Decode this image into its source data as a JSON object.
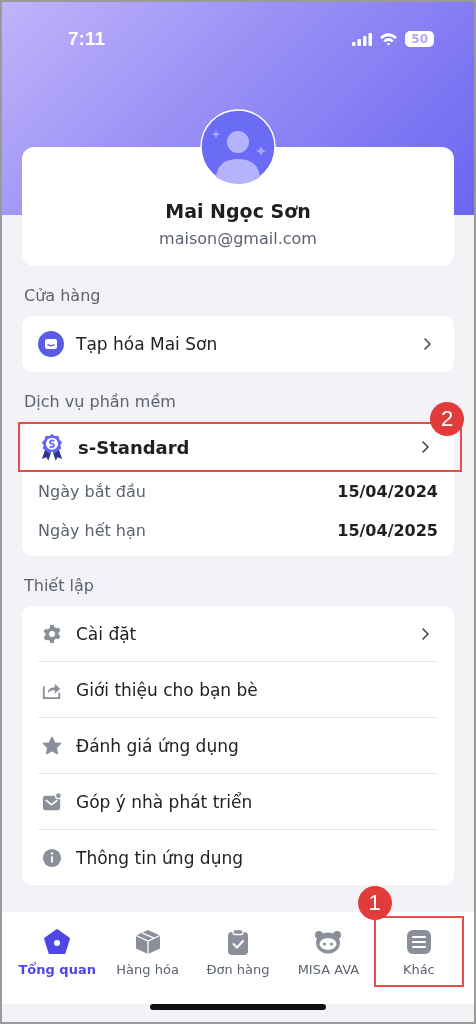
{
  "status_bar": {
    "time": "7:11",
    "battery": "50"
  },
  "profile": {
    "name": "Mai Ngọc Sơn",
    "email": "maison@gmail.com"
  },
  "store_section": {
    "label": "Cửa hàng",
    "item": {
      "name": "Tạp hóa Mai Sơn"
    }
  },
  "service_section": {
    "label": "Dịch vụ phần mềm",
    "plan": {
      "name": "s-Standard",
      "highlighted": true,
      "callout": "2"
    },
    "details": [
      {
        "label": "Ngày bắt đầu",
        "value": "15/04/2024"
      },
      {
        "label": "Ngày hết hạn",
        "value": "15/04/2025"
      }
    ]
  },
  "settings_section": {
    "label": "Thiết lập",
    "items": [
      {
        "kind": "gear",
        "label": "Cài đặt",
        "chevron": true
      },
      {
        "kind": "share",
        "label": "Giới thiệu cho bạn bè",
        "chevron": false
      },
      {
        "kind": "star",
        "label": "Đánh giá ứng dụng",
        "chevron": false
      },
      {
        "kind": "feedback",
        "label": "Góp ý nhà phát triển",
        "chevron": false
      },
      {
        "kind": "info",
        "label": "Thông tin ứng dụng",
        "chevron": false
      }
    ]
  },
  "tab_bar": [
    {
      "kind": "home",
      "label": "Tổng quan",
      "selected": true,
      "highlighted": false
    },
    {
      "kind": "box",
      "label": "Hàng hóa",
      "selected": false,
      "highlighted": false
    },
    {
      "kind": "order",
      "label": "Đơn hàng",
      "selected": false,
      "highlighted": false
    },
    {
      "kind": "bot",
      "label": "MISA AVA",
      "selected": false,
      "highlighted": false
    },
    {
      "kind": "menu",
      "label": "Khác",
      "selected": false,
      "highlighted": true,
      "callout": "1"
    }
  ]
}
